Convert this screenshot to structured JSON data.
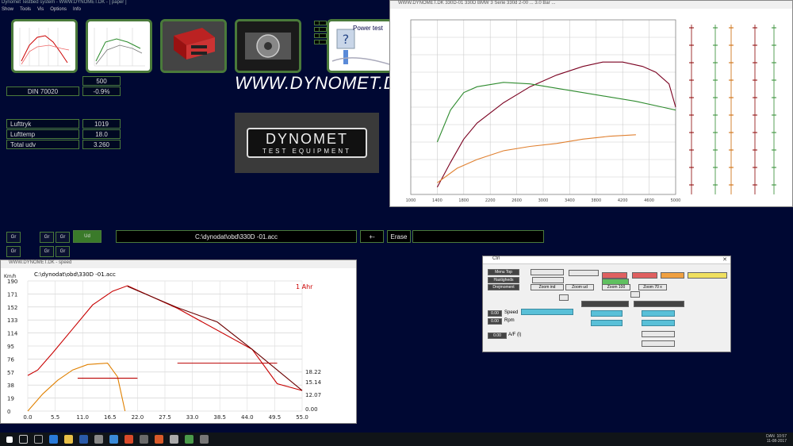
{
  "app": {
    "title": "Dynomet Testbed system - WWW.DYNOMET.DK - [ paper ]",
    "menu": [
      "Show",
      "Tools",
      "Vis",
      "Options",
      "Info"
    ]
  },
  "left_panel": {
    "rpm_value": "500",
    "din_label": "DIN 70020",
    "din_value": "-0.9%",
    "fields": [
      {
        "label": "Lufttryk",
        "value": "1019"
      },
      {
        "label": "Lufttemp",
        "value": "18.0"
      },
      {
        "label": "Total udv",
        "value": "3.260"
      }
    ],
    "url": "WWW.DYNOMET.DK",
    "logo": {
      "line1": "DYNOMET",
      "line2": "TEST EQUIPMENT"
    },
    "power_test_label": "Power test"
  },
  "bottom_controls": {
    "file_path": "C:\\dynodat\\obd\\330D -01.acc",
    "nav_label": "+-",
    "erase_label": "Erase",
    "btn_labels": [
      "Gr",
      "Gr",
      "Gr",
      "Gr",
      "Gr",
      "Ud"
    ]
  },
  "power_window": {
    "title": "WWW.DYNOMET.DK 330D-01  330D  BMW 3 Serie 330d 2-00 ... 3.0 Bar  ...",
    "right_axes": {
      "colors": [
        "#8b0000",
        "#2e8b2e",
        "#cc6600"
      ]
    },
    "chart_data": {
      "type": "line",
      "xlabel": "",
      "ylabel": "",
      "x": [
        1000,
        1400,
        1800,
        2200,
        2600,
        3000,
        3400,
        3800,
        4200,
        4600,
        5000
      ],
      "xticks": [
        "1000",
        "1400",
        "1800",
        "2200",
        "2600",
        "3000",
        "3400",
        "3800",
        "4200",
        "4600",
        "5000"
      ],
      "ylim": [
        0,
        600
      ],
      "series": [
        {
          "color": "#7a0020",
          "x": [
            1400,
            1600,
            1800,
            2000,
            2400,
            2800,
            3200,
            3600,
            3900,
            4200,
            4500,
            4700,
            4900,
            5000
          ],
          "y": [
            25,
            110,
            190,
            245,
            315,
            370,
            410,
            440,
            455,
            455,
            440,
            420,
            380,
            300
          ]
        },
        {
          "color": "#2e8b2e",
          "x": [
            1400,
            1600,
            1800,
            2000,
            2400,
            2800,
            3200,
            3600,
            4000,
            4400,
            4800,
            5000
          ],
          "y": [
            180,
            290,
            350,
            370,
            385,
            380,
            365,
            350,
            335,
            320,
            300,
            290
          ]
        },
        {
          "color": "#e08030",
          "x": [
            1400,
            1700,
            2000,
            2400,
            2800,
            3200,
            3600,
            4000,
            4400
          ],
          "y": [
            40,
            90,
            120,
            150,
            165,
            175,
            190,
            200,
            205
          ]
        }
      ]
    }
  },
  "speed_window": {
    "title": "WWW.DYNOMET.DK - speed",
    "file": "C:\\dynodat\\obd\\330D -01.acc",
    "corner_label": "1 Ahr",
    "right_values": [
      "18.22",
      "15.14",
      "12.07",
      "0.00"
    ],
    "chart_data": {
      "type": "line",
      "xlabel": "",
      "ylabel": "Km/h",
      "yticks": [
        "0",
        "19",
        "38",
        "57",
        "76",
        "95",
        "114",
        "133",
        "152",
        "171",
        "190"
      ],
      "xticks": [
        "0.0",
        "5.5",
        "11.0",
        "16.5",
        "22.0",
        "27.5",
        "33.0",
        "38.5",
        "44.0",
        "49.5",
        "55.0"
      ],
      "ylim": [
        0,
        190
      ],
      "xlim": [
        0,
        55
      ],
      "series": [
        {
          "color": "#c80000",
          "x": [
            0,
            2,
            5,
            9,
            13,
            17,
            20,
            30,
            45,
            50,
            55
          ],
          "y": [
            52,
            60,
            85,
            120,
            155,
            175,
            183,
            150,
            90,
            40,
            30
          ]
        },
        {
          "color": "#6b0000",
          "x": [
            20,
            30,
            38,
            45,
            55
          ],
          "y": [
            182,
            151,
            130,
            90,
            30
          ]
        },
        {
          "color": "#e08000",
          "x": [
            0,
            3,
            6,
            9,
            12,
            16,
            18,
            19.5
          ],
          "y": [
            0,
            25,
            45,
            60,
            68,
            70,
            50,
            0
          ]
        }
      ]
    }
  },
  "control_window": {
    "title": "Ctrl",
    "buttons": [
      "Menu Top",
      "Hastigheds",
      "Drejmoment",
      "Zoom ind",
      "Zoom ud",
      "Zoom 100",
      "Zoom 70 x"
    ],
    "speed_value": "0.00",
    "speed_label": "Speed",
    "rpm_value": "0.00",
    "rpm_label": "Rpm",
    "af_value": "0.00",
    "af_label": "A/F (l)"
  },
  "taskbar": {
    "time": "10:57",
    "date": "11-08-2017",
    "lang": "DAN"
  }
}
